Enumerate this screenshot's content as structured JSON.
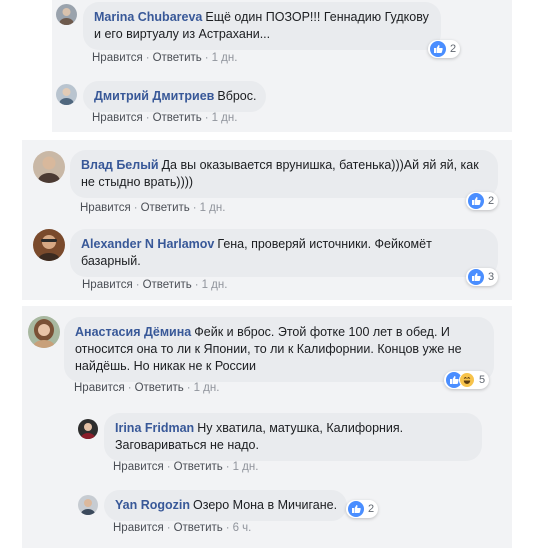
{
  "labels": {
    "like": "Нравится",
    "reply": "Ответить",
    "sep": "·"
  },
  "comments": [
    {
      "author": "Marina Chubareva",
      "text": "Ещё один ПОЗОР!!! Геннадию Гудкову и его виртуалу из Астрахани...",
      "time": "1 дн.",
      "reactions": "2",
      "avatar_icon": "person-avatar-icon"
    },
    {
      "author": "Дмитрий Дмитриев",
      "text": "Вброс.",
      "time": "1 дн.",
      "reactions": "",
      "avatar_icon": "person-avatar-icon"
    },
    {
      "author": "Влад Белый",
      "text": "Да вы оказывается врунишка, батенька)))Ай яй яй, как не стыдно врать))))",
      "time": "1 дн.",
      "reactions": "2",
      "avatar_icon": "person-avatar-icon"
    },
    {
      "author": "Alexander N Harlamov",
      "text": "Гена, проверяй источники. Фейкомёт базарный.",
      "time": "1 дн.",
      "reactions": "3",
      "avatar_icon": "person-avatar-icon"
    },
    {
      "author": "Анастасия Дёмина",
      "text": "Фейк и вброс. Этой фотке 100 лет в обед. И относится она то ли к Японии, то ли к Калифорнии. Концов уже не найдёшь. Но никак не к России",
      "time": "1 дн.",
      "reactions": "5",
      "avatar_icon": "person-avatar-icon"
    },
    {
      "author": "Irina Fridman",
      "text": "Ну хватила, матушка, Калифорния. Заговариваться не надо.",
      "time": "1 дн.",
      "reactions": "",
      "avatar_icon": "person-avatar-icon"
    },
    {
      "author": "Yan Rogozin",
      "text": "Озеро Мона в Мичигане.",
      "time": "6 ч.",
      "reactions": "2",
      "avatar_icon": "person-avatar-icon"
    }
  ],
  "colors": {
    "author": "#385898",
    "bubble": "#e9ebee",
    "panel": "#f2f3f5",
    "like": "#4a8eff",
    "haha": "#f7c34b"
  }
}
